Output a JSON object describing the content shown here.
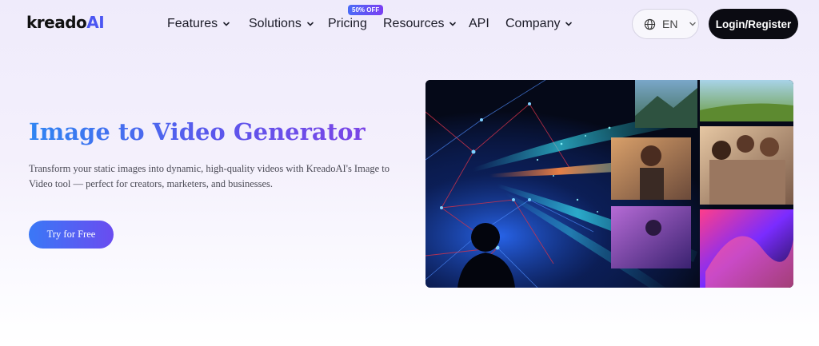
{
  "brand": {
    "name_main": "kreado",
    "name_ai": "AI"
  },
  "nav": {
    "items": [
      {
        "label": "Features",
        "dropdown": true
      },
      {
        "label": "Solutions",
        "dropdown": true
      },
      {
        "label": "Pricing",
        "dropdown": false
      },
      {
        "label": "Resources",
        "dropdown": true
      },
      {
        "label": "API",
        "dropdown": false
      },
      {
        "label": "Company",
        "dropdown": true
      }
    ],
    "pricing_badge": "50% OFF"
  },
  "header": {
    "language": "EN",
    "login_label": "Login/Register"
  },
  "hero": {
    "title": "Image to Video Generator",
    "description": "Transform your static images into dynamic, high-quality videos with KreadoAI's Image to Video tool — perfect for creators, marketers, and businesses.",
    "cta_label": "Try for Free"
  },
  "colors": {
    "accent_blue": "#2f85f2",
    "accent_purple": "#7b45e6",
    "dark_button": "#0b0b12"
  },
  "icons": [
    "globe-icon",
    "chevron-down-icon"
  ]
}
